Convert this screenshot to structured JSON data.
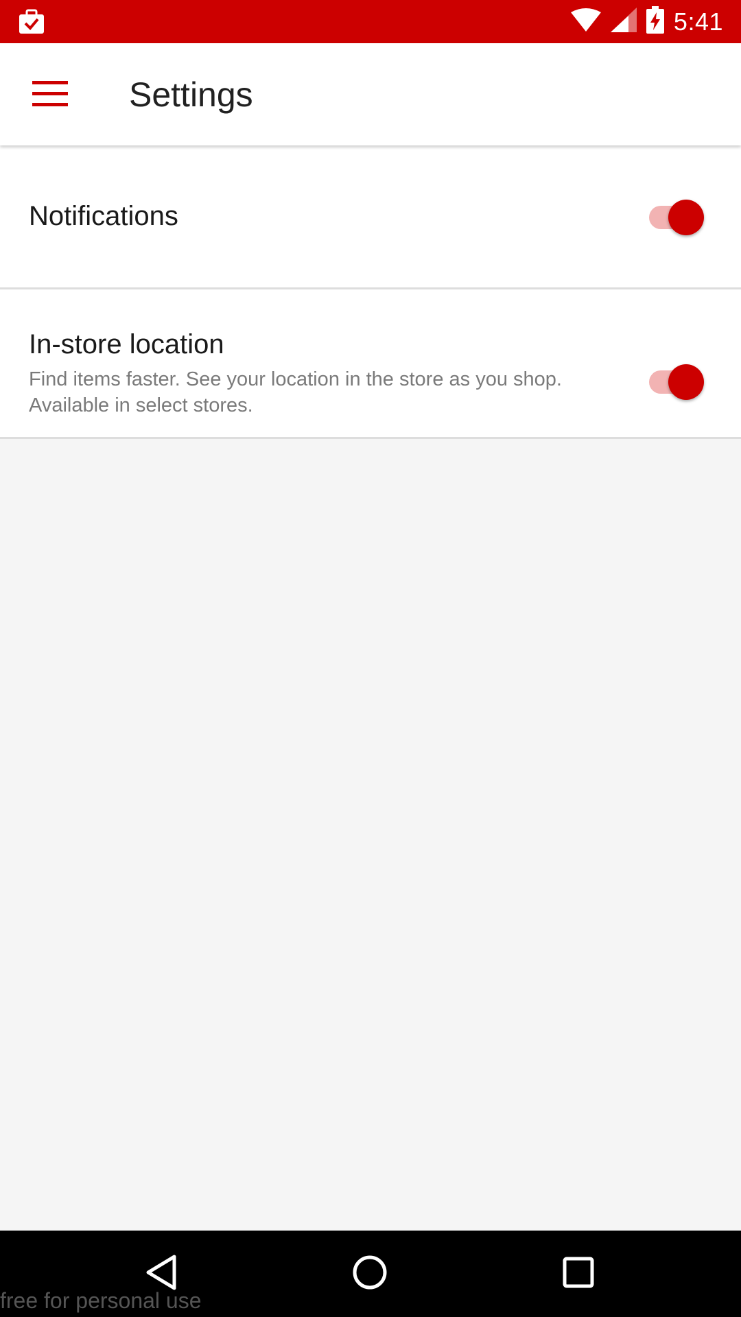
{
  "status_bar": {
    "time": "5:41",
    "icons": [
      "briefcase-check-icon",
      "wifi-icon",
      "cell-signal-icon",
      "battery-charging-icon"
    ],
    "background": "#cc0000"
  },
  "app_bar": {
    "title": "Settings",
    "menu_icon": "hamburger-menu-icon",
    "accent": "#cc0000"
  },
  "settings": {
    "notifications": {
      "label": "Notifications",
      "enabled": true
    },
    "in_store_location": {
      "label": "In-store location",
      "description": "Find items faster. See your location in the store as you shop. Available in select stores.",
      "enabled": true
    }
  },
  "nav_bar": {
    "icons": [
      "back-icon",
      "home-icon",
      "recents-icon"
    ]
  },
  "watermark": "free for personal use"
}
